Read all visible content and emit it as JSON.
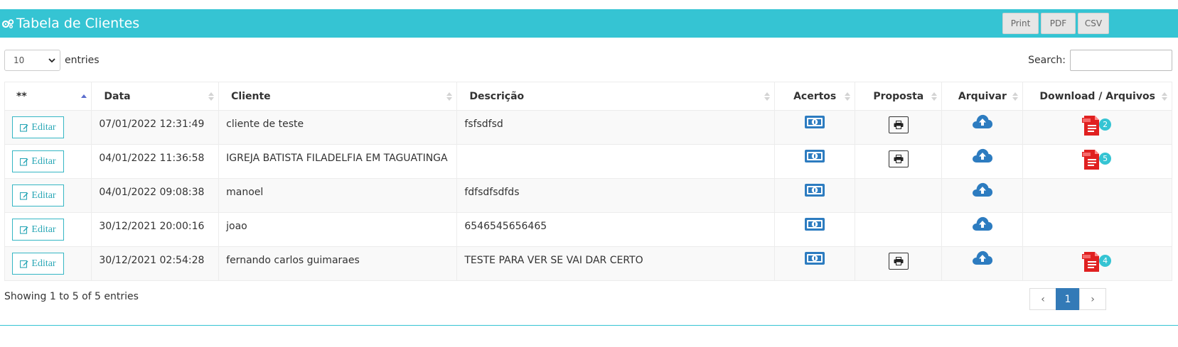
{
  "header": {
    "title": "Tabela de Clientes",
    "icon": "gears-icon"
  },
  "export_buttons": [
    "Print",
    "PDF",
    "CSV"
  ],
  "length": {
    "value": "10",
    "label": "entries"
  },
  "search": {
    "label": "Search:",
    "value": ""
  },
  "columns": [
    "**",
    "Data",
    "Cliente",
    "Descrição",
    "Acertos",
    "Proposta",
    "Arquivar",
    "Download / Arquivos"
  ],
  "edit_label": "Editar",
  "rows": [
    {
      "date": "07/01/2022 12:31:49",
      "client": "cliente de teste",
      "description": "fsfsdfsd",
      "proposta": true,
      "files": "2"
    },
    {
      "date": "04/01/2022 11:36:58",
      "client": "IGREJA BATISTA FILADELFIA EM TAGUATINGA",
      "description": "",
      "proposta": true,
      "files": "5"
    },
    {
      "date": "04/01/2022 09:08:38",
      "client": "manoel",
      "description": "fdfsdfsdfds",
      "proposta": false,
      "files": ""
    },
    {
      "date": "30/12/2021 20:00:16",
      "client": "joao",
      "description": "6546545656465",
      "proposta": false,
      "files": ""
    },
    {
      "date": "30/12/2021 02:54:28",
      "client": "fernando carlos guimaraes",
      "description": "TESTE PARA VER SE VAI DAR CERTO",
      "proposta": true,
      "files": "4"
    }
  ],
  "info": "Showing 1 to 5 of 5 entries",
  "pagination": {
    "prev": "‹",
    "current": "1",
    "next": "›"
  },
  "colors": {
    "accent": "#35c4d3",
    "primary": "#337ab7",
    "pdf_red": "#e02020",
    "icon_blue": "#2d7cc0"
  }
}
